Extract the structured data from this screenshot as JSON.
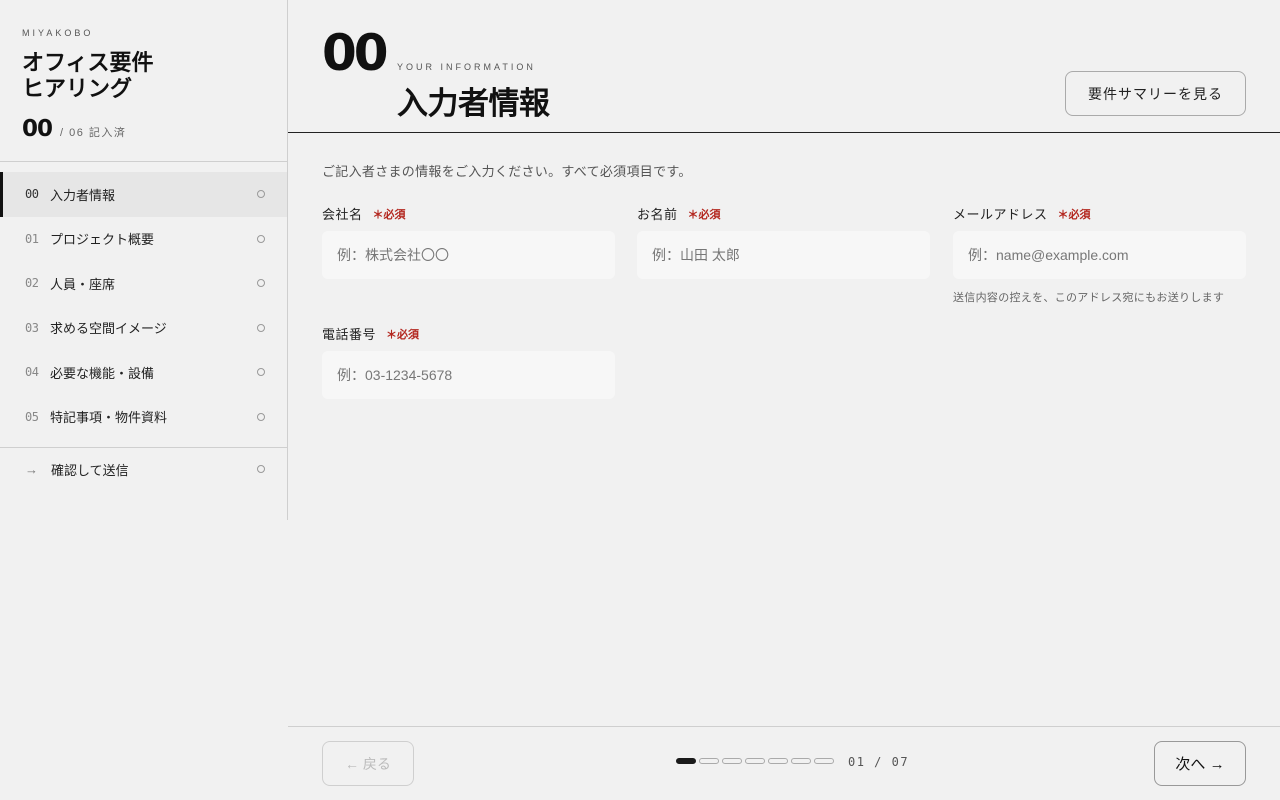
{
  "sidebar": {
    "brand": "MIYAKOBO",
    "title_line1": "オフィス要件",
    "title_line2": "ヒアリング",
    "progress_done": "00",
    "progress_total": "/ 06 記入済",
    "items": [
      {
        "num": "00",
        "label": "入力者情報"
      },
      {
        "num": "01",
        "label": "プロジェクト概要"
      },
      {
        "num": "02",
        "label": "人員・座席"
      },
      {
        "num": "03",
        "label": "求める空間イメージ"
      },
      {
        "num": "04",
        "label": "必要な機能・設備"
      },
      {
        "num": "05",
        "label": "特記事項・物件資料"
      }
    ],
    "confirm": {
      "arrow": "→",
      "label": "確認して送信"
    }
  },
  "header": {
    "step_num": "00",
    "step_sub": "YOUR INFORMATION",
    "step_title": "入力者情報",
    "summary_button": "要件サマリーを見る"
  },
  "form": {
    "intro": "ご記入者さまの情報をご入力ください。すべて必須項目です。",
    "required_mark": "＊必須",
    "fields": {
      "company": {
        "label": "会社名",
        "placeholder": "例：株式会社〇〇"
      },
      "name": {
        "label": "お名前",
        "placeholder": "例：山田 太郎"
      },
      "email": {
        "label": "メールアドレス",
        "placeholder": "例：name@example.com",
        "note": "送信内容の控えを、このアドレス宛にもお送りします"
      },
      "phone": {
        "label": "電話番号",
        "placeholder": "例：03-1234-5678"
      }
    }
  },
  "footer": {
    "back": "← 戻る",
    "next": "次へ →",
    "page_count": "01 / 07",
    "current_page": 1,
    "total_pages": 7
  },
  "colors": {
    "accent": "#1a1a1a",
    "required": "#b3261e",
    "background": "#f1f1f1"
  }
}
